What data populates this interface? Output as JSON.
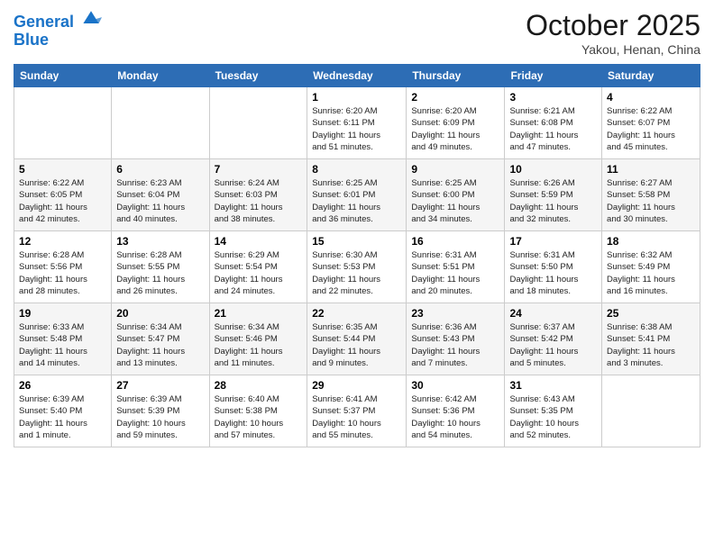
{
  "header": {
    "logo_line1": "General",
    "logo_line2": "Blue",
    "month": "October 2025",
    "location": "Yakou, Henan, China"
  },
  "days_of_week": [
    "Sunday",
    "Monday",
    "Tuesday",
    "Wednesday",
    "Thursday",
    "Friday",
    "Saturday"
  ],
  "weeks": [
    [
      {
        "day": "",
        "info": ""
      },
      {
        "day": "",
        "info": ""
      },
      {
        "day": "",
        "info": ""
      },
      {
        "day": "1",
        "info": "Sunrise: 6:20 AM\nSunset: 6:11 PM\nDaylight: 11 hours\nand 51 minutes."
      },
      {
        "day": "2",
        "info": "Sunrise: 6:20 AM\nSunset: 6:09 PM\nDaylight: 11 hours\nand 49 minutes."
      },
      {
        "day": "3",
        "info": "Sunrise: 6:21 AM\nSunset: 6:08 PM\nDaylight: 11 hours\nand 47 minutes."
      },
      {
        "day": "4",
        "info": "Sunrise: 6:22 AM\nSunset: 6:07 PM\nDaylight: 11 hours\nand 45 minutes."
      }
    ],
    [
      {
        "day": "5",
        "info": "Sunrise: 6:22 AM\nSunset: 6:05 PM\nDaylight: 11 hours\nand 42 minutes."
      },
      {
        "day": "6",
        "info": "Sunrise: 6:23 AM\nSunset: 6:04 PM\nDaylight: 11 hours\nand 40 minutes."
      },
      {
        "day": "7",
        "info": "Sunrise: 6:24 AM\nSunset: 6:03 PM\nDaylight: 11 hours\nand 38 minutes."
      },
      {
        "day": "8",
        "info": "Sunrise: 6:25 AM\nSunset: 6:01 PM\nDaylight: 11 hours\nand 36 minutes."
      },
      {
        "day": "9",
        "info": "Sunrise: 6:25 AM\nSunset: 6:00 PM\nDaylight: 11 hours\nand 34 minutes."
      },
      {
        "day": "10",
        "info": "Sunrise: 6:26 AM\nSunset: 5:59 PM\nDaylight: 11 hours\nand 32 minutes."
      },
      {
        "day": "11",
        "info": "Sunrise: 6:27 AM\nSunset: 5:58 PM\nDaylight: 11 hours\nand 30 minutes."
      }
    ],
    [
      {
        "day": "12",
        "info": "Sunrise: 6:28 AM\nSunset: 5:56 PM\nDaylight: 11 hours\nand 28 minutes."
      },
      {
        "day": "13",
        "info": "Sunrise: 6:28 AM\nSunset: 5:55 PM\nDaylight: 11 hours\nand 26 minutes."
      },
      {
        "day": "14",
        "info": "Sunrise: 6:29 AM\nSunset: 5:54 PM\nDaylight: 11 hours\nand 24 minutes."
      },
      {
        "day": "15",
        "info": "Sunrise: 6:30 AM\nSunset: 5:53 PM\nDaylight: 11 hours\nand 22 minutes."
      },
      {
        "day": "16",
        "info": "Sunrise: 6:31 AM\nSunset: 5:51 PM\nDaylight: 11 hours\nand 20 minutes."
      },
      {
        "day": "17",
        "info": "Sunrise: 6:31 AM\nSunset: 5:50 PM\nDaylight: 11 hours\nand 18 minutes."
      },
      {
        "day": "18",
        "info": "Sunrise: 6:32 AM\nSunset: 5:49 PM\nDaylight: 11 hours\nand 16 minutes."
      }
    ],
    [
      {
        "day": "19",
        "info": "Sunrise: 6:33 AM\nSunset: 5:48 PM\nDaylight: 11 hours\nand 14 minutes."
      },
      {
        "day": "20",
        "info": "Sunrise: 6:34 AM\nSunset: 5:47 PM\nDaylight: 11 hours\nand 13 minutes."
      },
      {
        "day": "21",
        "info": "Sunrise: 6:34 AM\nSunset: 5:46 PM\nDaylight: 11 hours\nand 11 minutes."
      },
      {
        "day": "22",
        "info": "Sunrise: 6:35 AM\nSunset: 5:44 PM\nDaylight: 11 hours\nand 9 minutes."
      },
      {
        "day": "23",
        "info": "Sunrise: 6:36 AM\nSunset: 5:43 PM\nDaylight: 11 hours\nand 7 minutes."
      },
      {
        "day": "24",
        "info": "Sunrise: 6:37 AM\nSunset: 5:42 PM\nDaylight: 11 hours\nand 5 minutes."
      },
      {
        "day": "25",
        "info": "Sunrise: 6:38 AM\nSunset: 5:41 PM\nDaylight: 11 hours\nand 3 minutes."
      }
    ],
    [
      {
        "day": "26",
        "info": "Sunrise: 6:39 AM\nSunset: 5:40 PM\nDaylight: 11 hours\nand 1 minute."
      },
      {
        "day": "27",
        "info": "Sunrise: 6:39 AM\nSunset: 5:39 PM\nDaylight: 10 hours\nand 59 minutes."
      },
      {
        "day": "28",
        "info": "Sunrise: 6:40 AM\nSunset: 5:38 PM\nDaylight: 10 hours\nand 57 minutes."
      },
      {
        "day": "29",
        "info": "Sunrise: 6:41 AM\nSunset: 5:37 PM\nDaylight: 10 hours\nand 55 minutes."
      },
      {
        "day": "30",
        "info": "Sunrise: 6:42 AM\nSunset: 5:36 PM\nDaylight: 10 hours\nand 54 minutes."
      },
      {
        "day": "31",
        "info": "Sunrise: 6:43 AM\nSunset: 5:35 PM\nDaylight: 10 hours\nand 52 minutes."
      },
      {
        "day": "",
        "info": ""
      }
    ]
  ]
}
